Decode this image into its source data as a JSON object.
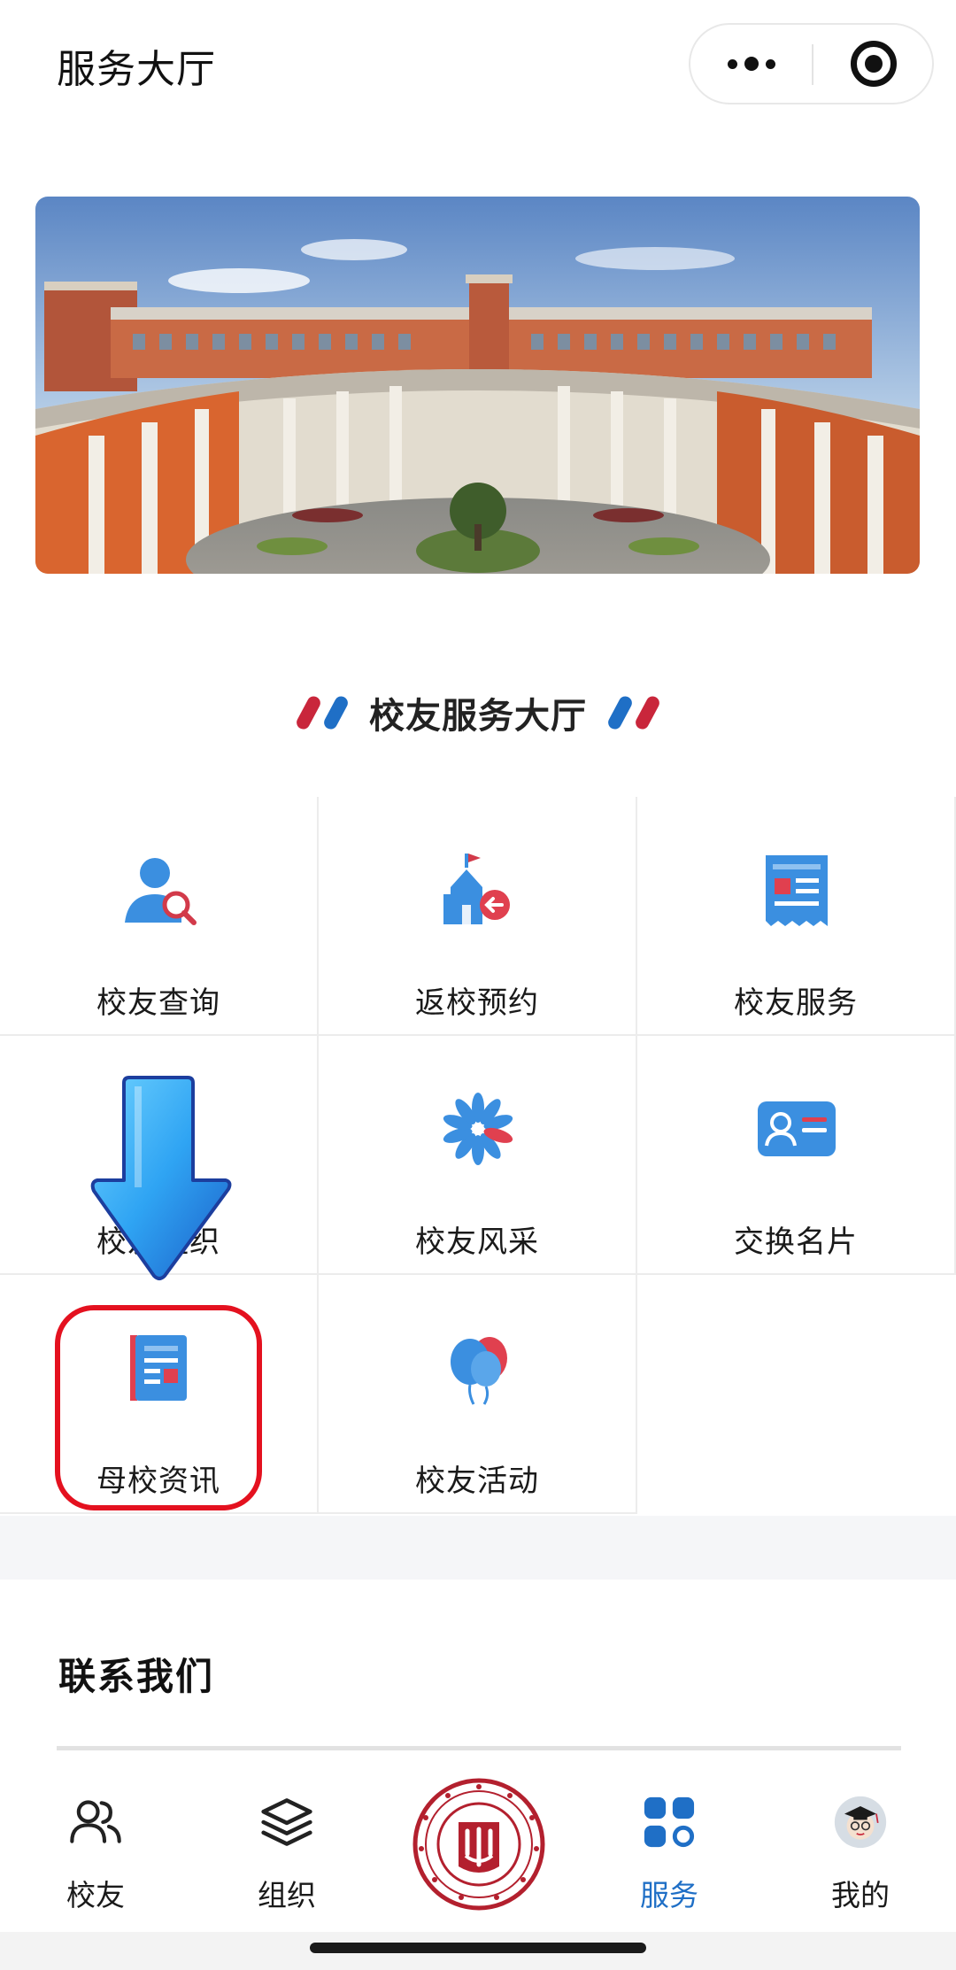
{
  "header": {
    "title": "服务大厅"
  },
  "section": {
    "title": "校友服务大厅"
  },
  "services": [
    {
      "label": "校友查询",
      "icon": "alumni-search-icon"
    },
    {
      "label": "返校预约",
      "icon": "school-return-icon"
    },
    {
      "label": "校友服务",
      "icon": "document-list-icon"
    },
    {
      "label": "校友组织",
      "icon": "organization-icon"
    },
    {
      "label": "校友风采",
      "icon": "pinwheel-icon"
    },
    {
      "label": "交换名片",
      "icon": "business-card-icon"
    },
    {
      "label": "母校资讯",
      "icon": "news-icon"
    },
    {
      "label": "校友活动",
      "icon": "balloons-icon"
    }
  ],
  "contact": {
    "title": "联系我们"
  },
  "tabbar": {
    "items": [
      {
        "label": "校友",
        "icon": "people-icon"
      },
      {
        "label": "组织",
        "icon": "layers-icon"
      },
      {
        "label": "",
        "icon": "university-emblem"
      },
      {
        "label": "服务",
        "icon": "grid-apps-icon",
        "active": true
      },
      {
        "label": "我的",
        "icon": "avatar-icon"
      }
    ]
  },
  "colors": {
    "accent_blue": "#1f6fc6",
    "accent_red": "#c9263b",
    "highlight_red": "#e4111f"
  }
}
